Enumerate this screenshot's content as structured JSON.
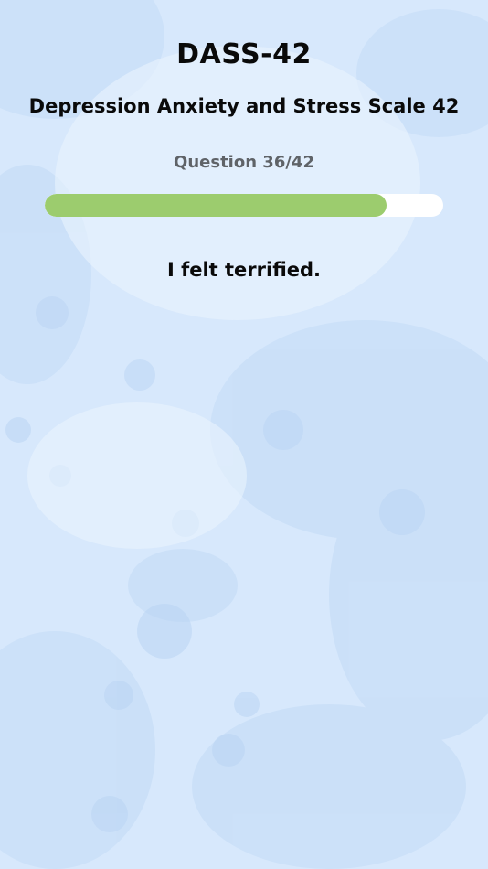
{
  "app": {
    "title": "DASS-42",
    "subtitle": "Depression Anxiety and Stress Scale 42"
  },
  "progress": {
    "label": "Question 36/42",
    "fraction": 0.857,
    "fill_color": "#9ccc6e",
    "track_color": "#ffffff"
  },
  "question": {
    "text": "I felt terrified."
  },
  "colors": {
    "background": "#d6e7fb",
    "text": "#0a0a0a",
    "counter_text": "#5f6368"
  }
}
